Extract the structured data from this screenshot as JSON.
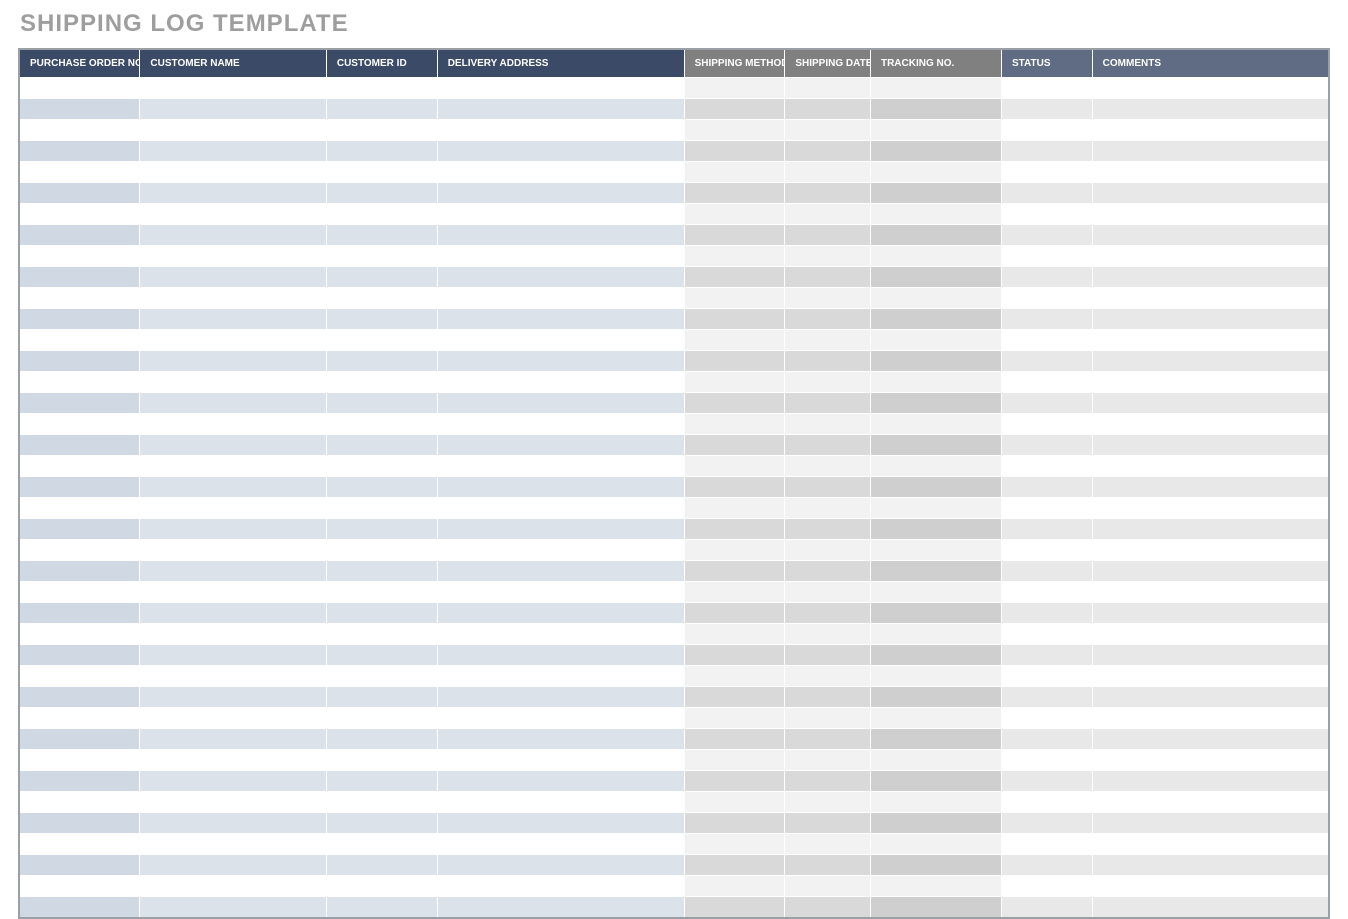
{
  "title": "SHIPPING LOG TEMPLATE",
  "columns": [
    {
      "label": "PURCHASE ORDER NO.",
      "group": "blue",
      "lead": true
    },
    {
      "label": "CUSTOMER NAME",
      "group": "blue",
      "lead": false
    },
    {
      "label": "CUSTOMER ID",
      "group": "blue",
      "lead": false
    },
    {
      "label": "DELIVERY ADDRESS",
      "group": "blue",
      "lead": false
    },
    {
      "label": "SHIPPING METHOD",
      "group": "grey",
      "lead": false
    },
    {
      "label": "SHIPPING DATE",
      "group": "grey",
      "lead": false
    },
    {
      "label": "TRACKING NO.",
      "group": "grey",
      "lead": false,
      "track": true
    },
    {
      "label": "STATUS",
      "group": "mid",
      "lead": false
    },
    {
      "label": "COMMENTS",
      "group": "mid",
      "lead": false
    }
  ],
  "row_count": 40,
  "rows": []
}
